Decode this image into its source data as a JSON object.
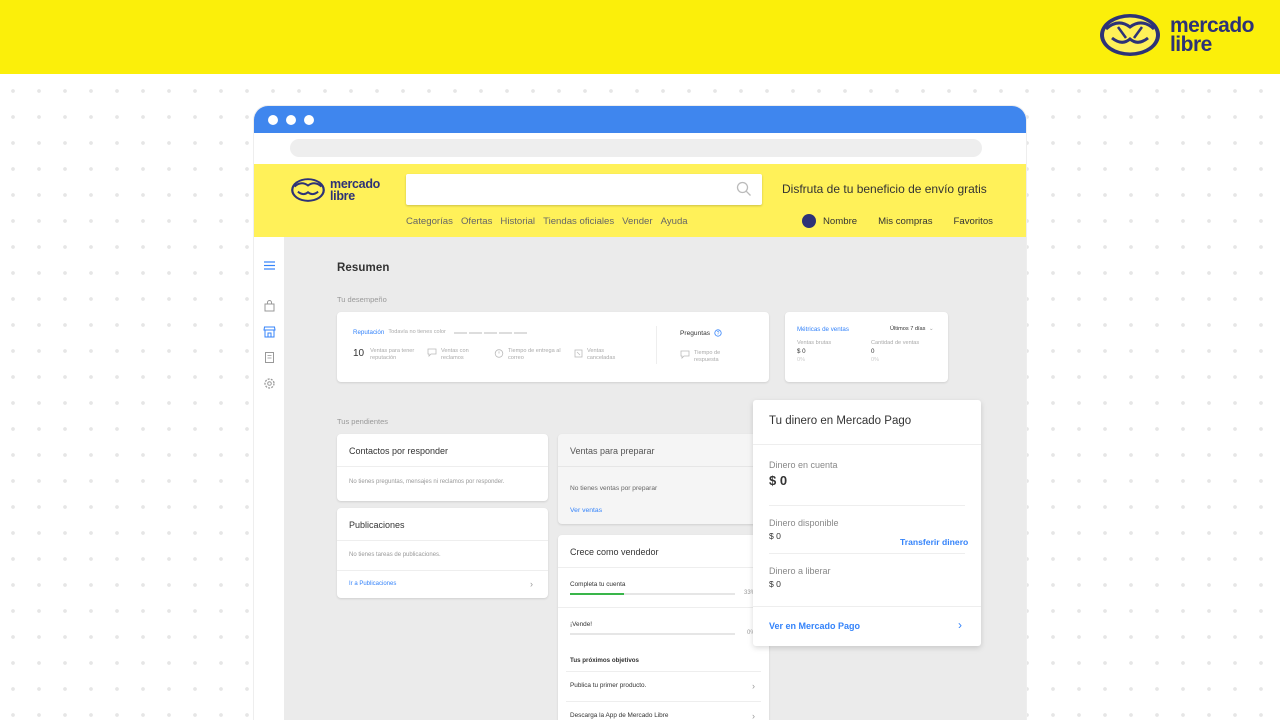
{
  "brand": {
    "line1": "mercado",
    "line2": "libre"
  },
  "site": {
    "logo_line1": "mercado",
    "logo_line2": "libre",
    "promo": "Disfruta de tu beneficio de envío gratis",
    "nav": [
      "Categorías",
      "Ofertas",
      "Historial",
      "Tiendas oficiales",
      "Vender",
      "Ayuda"
    ],
    "user": {
      "name": "Nombre",
      "purchases": "Mis compras",
      "favorites": "Favoritos"
    }
  },
  "sidebar_icons": [
    "menu-icon",
    "bag-icon",
    "store-icon",
    "receipt-icon",
    "settings-icon"
  ],
  "summary": {
    "title": "Resumen",
    "performance_label": "Tu desempeño",
    "reputation": {
      "label": "Reputación",
      "note": "Todavía no tienes color",
      "count": "10",
      "count_label": "Ventas para tener reputación",
      "stats": [
        "Ventas con reclamos",
        "Tiempo de entrega al correo",
        "Ventas canceladas"
      ]
    },
    "questions": {
      "label": "Preguntas",
      "stat": "Tiempo de respuesta"
    },
    "metrics": {
      "title": "Métricas de ventas",
      "range": "Últimos 7 días",
      "gross_label": "Ventas brutas",
      "gross_value": "$ 0",
      "gross_pct": "0%",
      "count_label": "Cantidad de ventas",
      "count_value": "0",
      "count_pct": "0%"
    }
  },
  "pending": {
    "title": "Tus pendientes",
    "contacts": {
      "title": "Contactos por responder",
      "empty": "No tienes preguntas, mensajes ni reclamos por responder."
    },
    "publications": {
      "title": "Publicaciones",
      "empty": "No tienes tareas de publicaciones.",
      "link": "Ir a Publicaciones"
    },
    "sales": {
      "title": "Ventas para preparar",
      "empty": "No tienes ventas por preparar",
      "link": "Ver ventas"
    },
    "grow": {
      "title": "Crece como vendedor",
      "task1": {
        "label": "Completa tu cuenta",
        "pct_text": "33%",
        "progress": 0.33
      },
      "task2": {
        "label": "¡Vende!",
        "pct_text": "0%",
        "progress": 0
      },
      "next_title": "Tus próximos objetivos",
      "goals": [
        "Publica tu primer producto.",
        "Descarga la App de Mercado Libre"
      ]
    }
  },
  "money": {
    "title": "Tu dinero en Mercado Pago",
    "in_account_label": "Dinero en cuenta",
    "in_account_value": "$ 0",
    "available_label": "Dinero disponible",
    "available_value": "$ 0",
    "transfer": "Transferir dinero",
    "to_release_label": "Dinero a liberar",
    "to_release_value": "$ 0",
    "link": "Ver en Mercado Pago"
  },
  "colors": {
    "band": "#fbef0a",
    "header": "#fff159",
    "chrome": "#3f86ee",
    "navy": "#2d3277",
    "link": "#3483fa",
    "progress": "#39b54a"
  }
}
